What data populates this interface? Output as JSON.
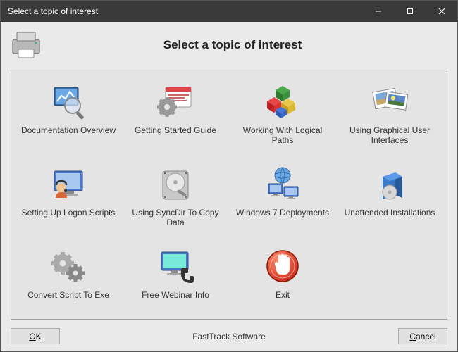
{
  "window": {
    "title": "Select a topic of interest"
  },
  "header": {
    "heading": "Select a topic of interest",
    "icon": "printer-icon"
  },
  "topics": [
    {
      "label": "Documentation Overview",
      "icon": "magnifier-chart-icon"
    },
    {
      "label": "Getting Started Guide",
      "icon": "gear-window-icon"
    },
    {
      "label": "Working With Logical Paths",
      "icon": "blocks-icon"
    },
    {
      "label": "Using Graphical User Interfaces",
      "icon": "pictures-icon"
    },
    {
      "label": "Setting Up Logon Scripts",
      "icon": "headset-user-icon"
    },
    {
      "label": "Using SyncDir To Copy Data",
      "icon": "harddisk-icon"
    },
    {
      "label": "Windows 7 Deployments",
      "icon": "globe-monitors-icon"
    },
    {
      "label": "Unattended Installations",
      "icon": "software-box-icon"
    },
    {
      "label": "Convert Script To Exe",
      "icon": "gears-icon"
    },
    {
      "label": "Free Webinar Info",
      "icon": "monitor-phone-icon"
    },
    {
      "label": "Exit",
      "icon": "stop-hand-icon"
    }
  ],
  "footer": {
    "ok_prefix": "O",
    "ok_rest": "K",
    "cancel_prefix": "C",
    "cancel_rest": "ancel",
    "brand": "FastTrack Software"
  }
}
